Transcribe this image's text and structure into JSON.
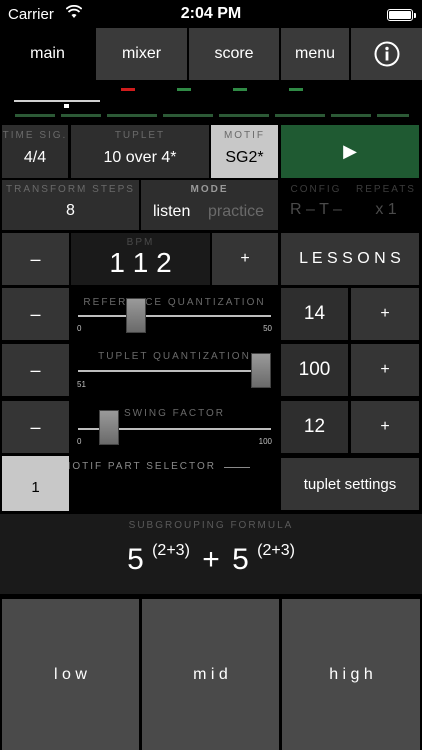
{
  "status_bar": {
    "carrier": "Carrier",
    "time": "2:04 PM"
  },
  "tabs": [
    "main",
    "mixer",
    "score",
    "menu"
  ],
  "time_sig": {
    "label": "TIME SIG.",
    "value": "4/4"
  },
  "tuplet": {
    "label": "TUPLET",
    "value": "10 over 4*"
  },
  "motif": {
    "label": "MOTIF",
    "value": "SG2*"
  },
  "play_symbol": "▶",
  "transform_steps": {
    "label": "TRANSFORM STEPS",
    "value": "8"
  },
  "mode": {
    "label": "MODE",
    "listen": "listen",
    "practice": "practice"
  },
  "config": {
    "label": "CONFIG",
    "value": "R – T –"
  },
  "repeats": {
    "label": "REPEATS",
    "value": "x 1"
  },
  "bpm": {
    "label": "BPM",
    "value": "1 1 2",
    "minus": "–",
    "plus": "+"
  },
  "lessons": "L E S S O N S",
  "reference_quantization": {
    "label": "REFERENCE QUANTIZATION",
    "min": "0",
    "max": "50",
    "value": "14",
    "level": 0.28,
    "minus": "–",
    "plus": "+"
  },
  "tuplet_quantization": {
    "label": "TUPLET QUANTIZATION",
    "min": "51",
    "value": "100",
    "level": 1.0,
    "minus": "–",
    "plus": "+"
  },
  "swing_factor": {
    "label": "SWING FACTOR",
    "min": "0",
    "max": "100",
    "value": "12",
    "level": 0.12,
    "minus": "–",
    "plus": "+"
  },
  "motif_part_selector": {
    "label": "MOTIF PART SELECTOR",
    "value": "1"
  },
  "tuplet_settings": "tuplet settings",
  "subgrouping": {
    "label": "SUBGROUPING FORMULA",
    "base1": "5",
    "exp1": "(2+3)",
    "op": "+",
    "base2": "5",
    "exp2": "(2+3)"
  },
  "pads": {
    "low": "l o w",
    "mid": "m i d",
    "high": "h i g h"
  },
  "colors": {
    "accent_green": "#1f5a32",
    "led_red": "#d01c1c",
    "led_green": "#2f8a45"
  },
  "progress": {
    "level": 0.6
  }
}
